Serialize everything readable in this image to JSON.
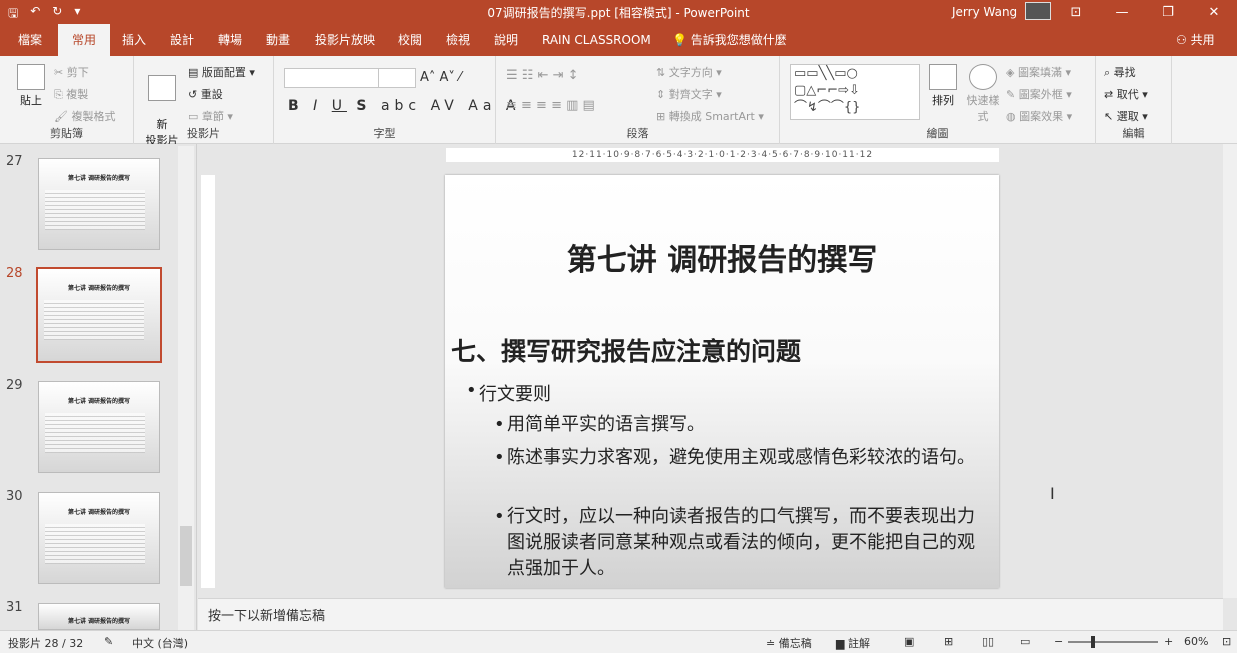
{
  "window": {
    "title": "07调研报告的撰写.ppt [相容模式] - PowerPoint",
    "user": "Jerry Wang"
  },
  "tabs": [
    "檔案",
    "常用",
    "插入",
    "設計",
    "轉場",
    "動畫",
    "投影片放映",
    "校閱",
    "檢視",
    "說明",
    "RAIN CLASSROOM"
  ],
  "active_tab": "常用",
  "tell_me": "告訴我您想做什麼",
  "share": "共用",
  "ribbon": {
    "clipboard": {
      "label": "剪貼簿",
      "paste": "貼上",
      "cut": "剪下",
      "copy": "複製",
      "format_painter": "複製格式"
    },
    "slides": {
      "label": "投影片",
      "new_slide": "新\n投影片",
      "layout": "版面配置",
      "reset": "重設",
      "section": "章節"
    },
    "font": {
      "label": "字型",
      "font_name": "",
      "font_size": ""
    },
    "paragraph": {
      "label": "段落",
      "text_direction": "文字方向",
      "align_text": "對齊文字",
      "smartart": "轉換成 SmartArt"
    },
    "drawing": {
      "label": "繪圖",
      "arrange": "排列",
      "quick_styles": "快速樣式",
      "shape_fill": "圖案填滿",
      "shape_outline": "圖案外框",
      "shape_effects": "圖案效果"
    },
    "editing": {
      "label": "編輯",
      "find": "尋找",
      "replace": "取代",
      "select": "選取"
    }
  },
  "thumbnails": [
    {
      "num": "27",
      "title": "第七讲 调研报告的撰写"
    },
    {
      "num": "28",
      "title": "第七讲 调研报告的撰写"
    },
    {
      "num": "29",
      "title": "第七讲 调研报告的撰写"
    },
    {
      "num": "30",
      "title": "第七讲 调研报告的撰写"
    },
    {
      "num": "31",
      "title": "第七讲 调研报告的撰写"
    }
  ],
  "slide": {
    "title": "第七讲  调研报告的撰写",
    "heading": "七、撰写研究报告应注意的问题",
    "bullet1": "行文要则",
    "sub1": "用简单平实的语言撰写。",
    "sub2": "陈述事实力求客观，避免使用主观或感情色彩较浓的语句。",
    "sub3": "行文时，应以一种向读者报告的口气撰写，而不要表现出力图说服读者同意某种观点或看法的倾向，更不能把自己的观点强加于人。"
  },
  "ruler": "12·11·10·9·8·7·6·5·4·3·2·1·0·1·2·3·4·5·6·7·8·9·10·11·12",
  "notes_placeholder": "按一下以新增備忘稿",
  "status": {
    "slide_indicator": "投影片 28 / 32",
    "language": "中文 (台灣)",
    "notes": "備忘稿",
    "comments": "註解",
    "zoom": "60%"
  }
}
